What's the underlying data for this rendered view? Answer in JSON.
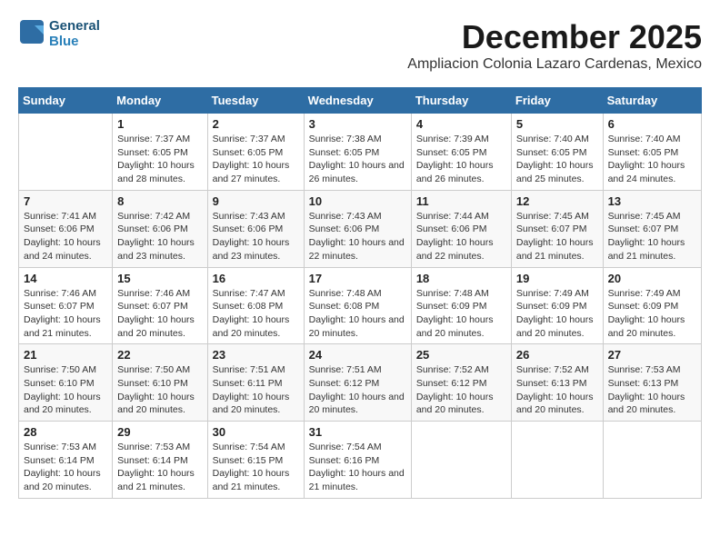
{
  "logo": {
    "line1": "General",
    "line2": "Blue"
  },
  "title": "December 2025",
  "subtitle": "Ampliacion Colonia Lazaro Cardenas, Mexico",
  "headers": [
    "Sunday",
    "Monday",
    "Tuesday",
    "Wednesday",
    "Thursday",
    "Friday",
    "Saturday"
  ],
  "weeks": [
    [
      {
        "day": "",
        "sunrise": "",
        "sunset": "",
        "daylight": ""
      },
      {
        "day": "1",
        "sunrise": "Sunrise: 7:37 AM",
        "sunset": "Sunset: 6:05 PM",
        "daylight": "Daylight: 10 hours and 28 minutes."
      },
      {
        "day": "2",
        "sunrise": "Sunrise: 7:37 AM",
        "sunset": "Sunset: 6:05 PM",
        "daylight": "Daylight: 10 hours and 27 minutes."
      },
      {
        "day": "3",
        "sunrise": "Sunrise: 7:38 AM",
        "sunset": "Sunset: 6:05 PM",
        "daylight": "Daylight: 10 hours and 26 minutes."
      },
      {
        "day": "4",
        "sunrise": "Sunrise: 7:39 AM",
        "sunset": "Sunset: 6:05 PM",
        "daylight": "Daylight: 10 hours and 26 minutes."
      },
      {
        "day": "5",
        "sunrise": "Sunrise: 7:40 AM",
        "sunset": "Sunset: 6:05 PM",
        "daylight": "Daylight: 10 hours and 25 minutes."
      },
      {
        "day": "6",
        "sunrise": "Sunrise: 7:40 AM",
        "sunset": "Sunset: 6:05 PM",
        "daylight": "Daylight: 10 hours and 24 minutes."
      }
    ],
    [
      {
        "day": "7",
        "sunrise": "Sunrise: 7:41 AM",
        "sunset": "Sunset: 6:06 PM",
        "daylight": "Daylight: 10 hours and 24 minutes."
      },
      {
        "day": "8",
        "sunrise": "Sunrise: 7:42 AM",
        "sunset": "Sunset: 6:06 PM",
        "daylight": "Daylight: 10 hours and 23 minutes."
      },
      {
        "day": "9",
        "sunrise": "Sunrise: 7:43 AM",
        "sunset": "Sunset: 6:06 PM",
        "daylight": "Daylight: 10 hours and 23 minutes."
      },
      {
        "day": "10",
        "sunrise": "Sunrise: 7:43 AM",
        "sunset": "Sunset: 6:06 PM",
        "daylight": "Daylight: 10 hours and 22 minutes."
      },
      {
        "day": "11",
        "sunrise": "Sunrise: 7:44 AM",
        "sunset": "Sunset: 6:06 PM",
        "daylight": "Daylight: 10 hours and 22 minutes."
      },
      {
        "day": "12",
        "sunrise": "Sunrise: 7:45 AM",
        "sunset": "Sunset: 6:07 PM",
        "daylight": "Daylight: 10 hours and 21 minutes."
      },
      {
        "day": "13",
        "sunrise": "Sunrise: 7:45 AM",
        "sunset": "Sunset: 6:07 PM",
        "daylight": "Daylight: 10 hours and 21 minutes."
      }
    ],
    [
      {
        "day": "14",
        "sunrise": "Sunrise: 7:46 AM",
        "sunset": "Sunset: 6:07 PM",
        "daylight": "Daylight: 10 hours and 21 minutes."
      },
      {
        "day": "15",
        "sunrise": "Sunrise: 7:46 AM",
        "sunset": "Sunset: 6:07 PM",
        "daylight": "Daylight: 10 hours and 20 minutes."
      },
      {
        "day": "16",
        "sunrise": "Sunrise: 7:47 AM",
        "sunset": "Sunset: 6:08 PM",
        "daylight": "Daylight: 10 hours and 20 minutes."
      },
      {
        "day": "17",
        "sunrise": "Sunrise: 7:48 AM",
        "sunset": "Sunset: 6:08 PM",
        "daylight": "Daylight: 10 hours and 20 minutes."
      },
      {
        "day": "18",
        "sunrise": "Sunrise: 7:48 AM",
        "sunset": "Sunset: 6:09 PM",
        "daylight": "Daylight: 10 hours and 20 minutes."
      },
      {
        "day": "19",
        "sunrise": "Sunrise: 7:49 AM",
        "sunset": "Sunset: 6:09 PM",
        "daylight": "Daylight: 10 hours and 20 minutes."
      },
      {
        "day": "20",
        "sunrise": "Sunrise: 7:49 AM",
        "sunset": "Sunset: 6:09 PM",
        "daylight": "Daylight: 10 hours and 20 minutes."
      }
    ],
    [
      {
        "day": "21",
        "sunrise": "Sunrise: 7:50 AM",
        "sunset": "Sunset: 6:10 PM",
        "daylight": "Daylight: 10 hours and 20 minutes."
      },
      {
        "day": "22",
        "sunrise": "Sunrise: 7:50 AM",
        "sunset": "Sunset: 6:10 PM",
        "daylight": "Daylight: 10 hours and 20 minutes."
      },
      {
        "day": "23",
        "sunrise": "Sunrise: 7:51 AM",
        "sunset": "Sunset: 6:11 PM",
        "daylight": "Daylight: 10 hours and 20 minutes."
      },
      {
        "day": "24",
        "sunrise": "Sunrise: 7:51 AM",
        "sunset": "Sunset: 6:12 PM",
        "daylight": "Daylight: 10 hours and 20 minutes."
      },
      {
        "day": "25",
        "sunrise": "Sunrise: 7:52 AM",
        "sunset": "Sunset: 6:12 PM",
        "daylight": "Daylight: 10 hours and 20 minutes."
      },
      {
        "day": "26",
        "sunrise": "Sunrise: 7:52 AM",
        "sunset": "Sunset: 6:13 PM",
        "daylight": "Daylight: 10 hours and 20 minutes."
      },
      {
        "day": "27",
        "sunrise": "Sunrise: 7:53 AM",
        "sunset": "Sunset: 6:13 PM",
        "daylight": "Daylight: 10 hours and 20 minutes."
      }
    ],
    [
      {
        "day": "28",
        "sunrise": "Sunrise: 7:53 AM",
        "sunset": "Sunset: 6:14 PM",
        "daylight": "Daylight: 10 hours and 20 minutes."
      },
      {
        "day": "29",
        "sunrise": "Sunrise: 7:53 AM",
        "sunset": "Sunset: 6:14 PM",
        "daylight": "Daylight: 10 hours and 21 minutes."
      },
      {
        "day": "30",
        "sunrise": "Sunrise: 7:54 AM",
        "sunset": "Sunset: 6:15 PM",
        "daylight": "Daylight: 10 hours and 21 minutes."
      },
      {
        "day": "31",
        "sunrise": "Sunrise: 7:54 AM",
        "sunset": "Sunset: 6:16 PM",
        "daylight": "Daylight: 10 hours and 21 minutes."
      },
      {
        "day": "",
        "sunrise": "",
        "sunset": "",
        "daylight": ""
      },
      {
        "day": "",
        "sunrise": "",
        "sunset": "",
        "daylight": ""
      },
      {
        "day": "",
        "sunrise": "",
        "sunset": "",
        "daylight": ""
      }
    ]
  ]
}
